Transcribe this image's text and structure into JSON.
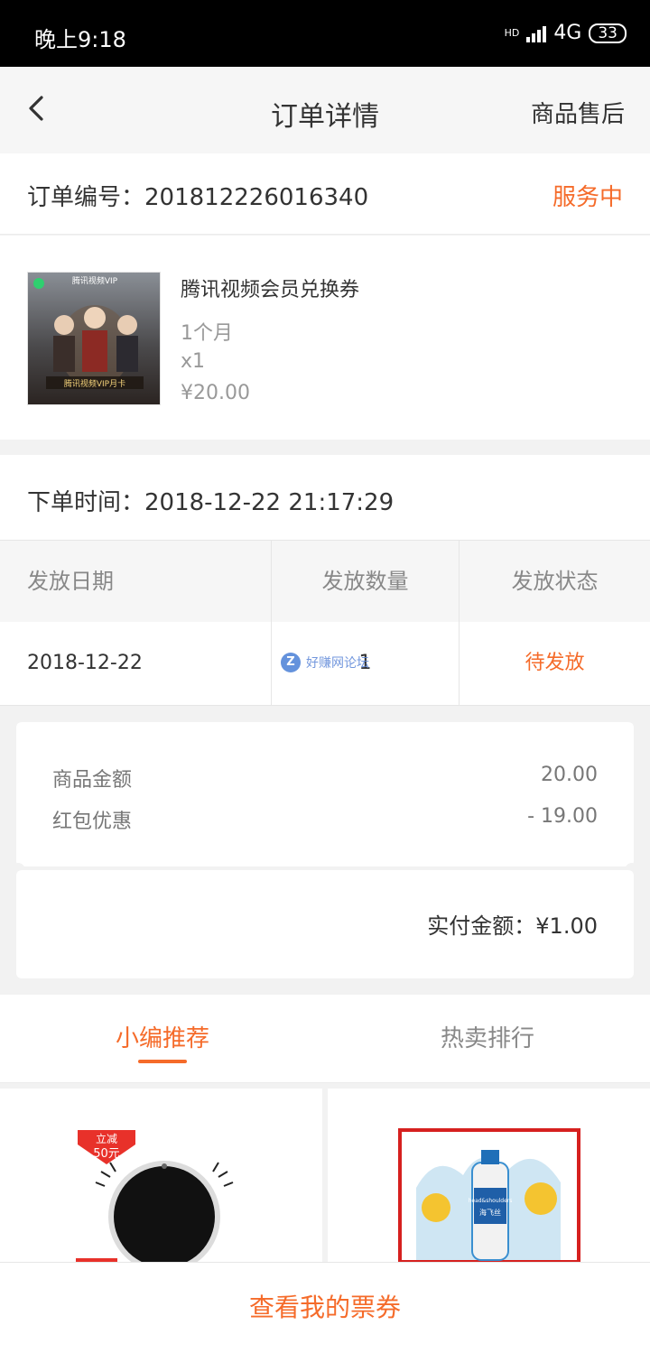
{
  "status_bar": {
    "time": "晚上9:18",
    "network": "4G",
    "battery": "33"
  },
  "nav": {
    "title": "订单详情",
    "right_action": "商品售后"
  },
  "order": {
    "number_text": "订单编号：201812226016340",
    "status": "服务中"
  },
  "product": {
    "thumb_brand": "腾讯视频VIP",
    "thumb_caption": "腾讯视频VIP月卡",
    "name": "腾讯视频会员兑换券",
    "spec": "1个月",
    "quantity": "x1",
    "price": "¥20.00"
  },
  "order_time": "下单时间：2018-12-22 21:17:29",
  "distribution": {
    "headers": [
      "发放日期",
      "发放数量",
      "发放状态"
    ],
    "rows": [
      {
        "date": "2018-12-22",
        "quantity": "1",
        "status": "待发放"
      }
    ]
  },
  "watermark": "好赚网论坛",
  "amounts": {
    "goods_label": "商品金额",
    "goods_value": "20.00",
    "coupon_label": "红包优惠",
    "coupon_value": "- 19.00",
    "total_text": "实付金额：¥1.00"
  },
  "tabs": [
    {
      "label": "小编推荐",
      "active": true
    },
    {
      "label": "热卖排行",
      "active": false
    }
  ],
  "recommend": {
    "left_badge_line1": "立减",
    "left_badge_line2": "50元",
    "right_bottle_brand": "head&shoulders",
    "right_bottle_cn": "海飞丝"
  },
  "bottom_button": "查看我的票券",
  "colors": {
    "accent": "#f56b2a",
    "text_primary": "#333333",
    "text_secondary": "#999999"
  }
}
